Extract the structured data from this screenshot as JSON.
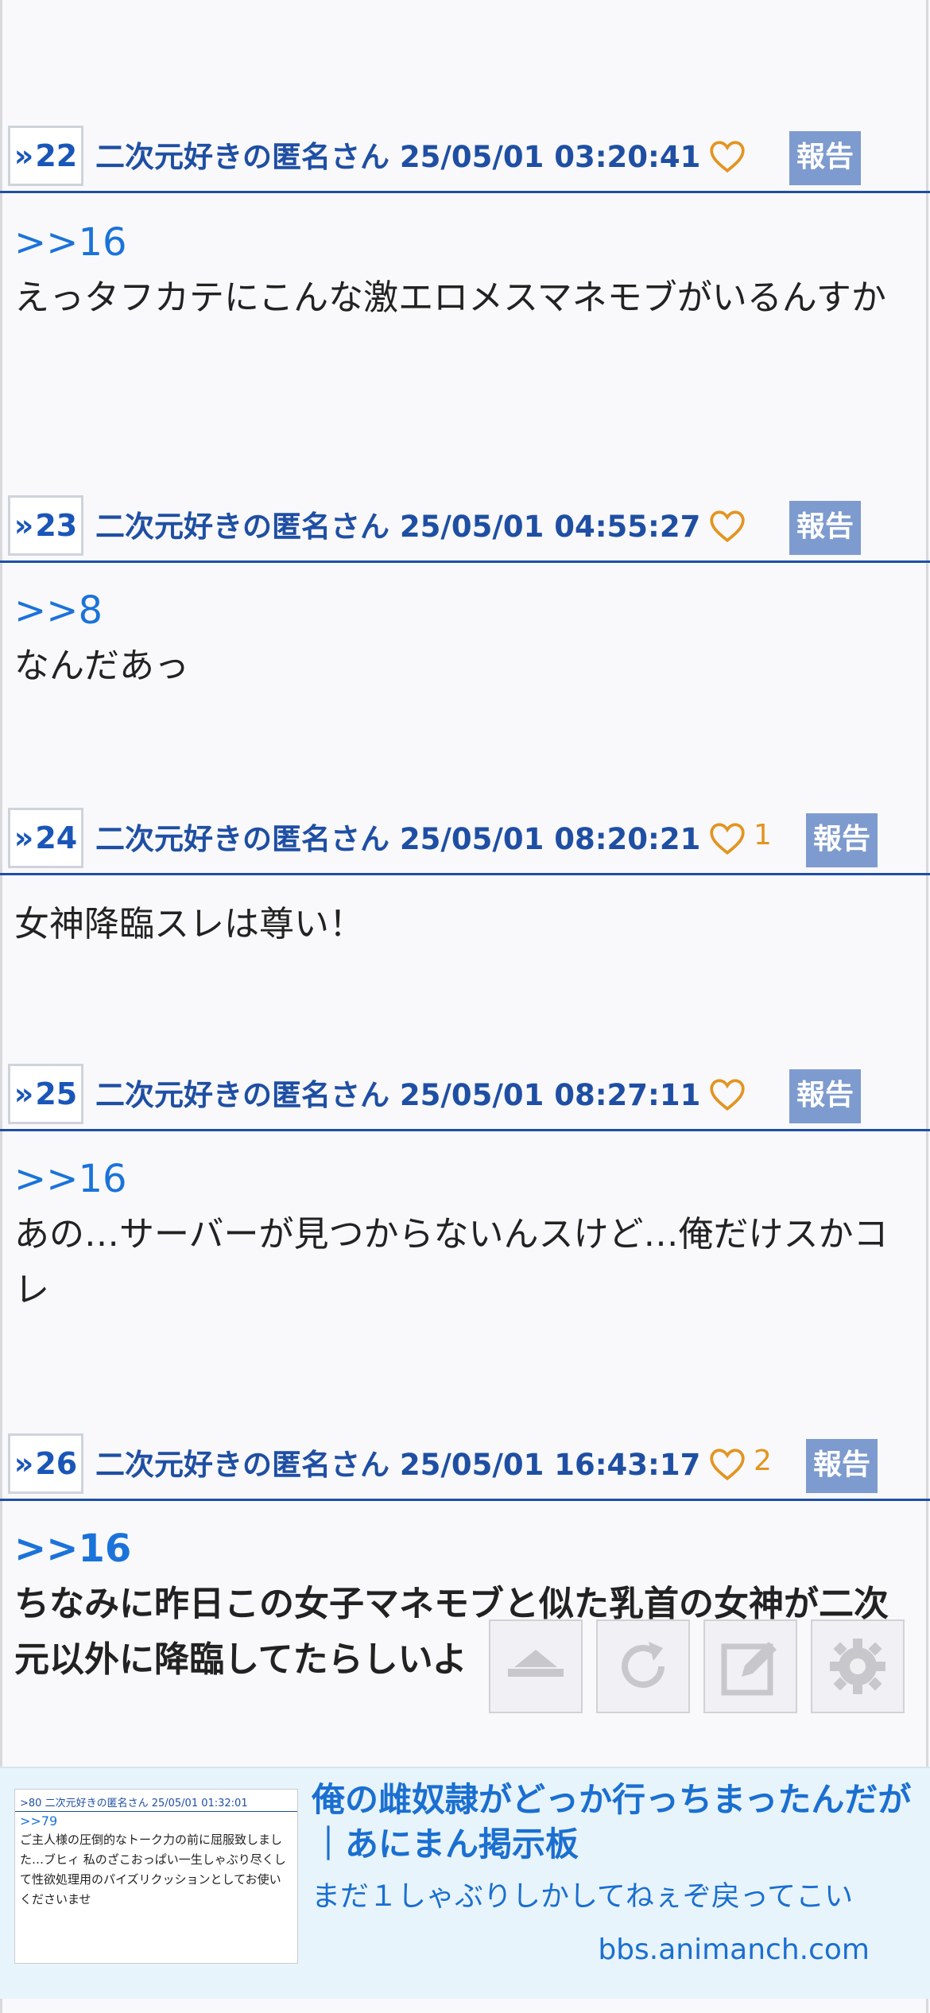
{
  "posts": [
    {
      "no": "22",
      "author": "二次元好きの匿名さん",
      "datetime": "25/05/01 03:20:41",
      "likes": "",
      "report": "報告",
      "anchor": ">>16",
      "text": "えっタフカテにこんな激エロメスマネモブがいるんすか"
    },
    {
      "no": "23",
      "author": "二次元好きの匿名さん",
      "datetime": "25/05/01 04:55:27",
      "likes": "",
      "report": "報告",
      "anchor": ">>8",
      "text": "なんだあっ"
    },
    {
      "no": "24",
      "author": "二次元好きの匿名さん",
      "datetime": "25/05/01 08:20:21",
      "likes": "1",
      "report": "報告",
      "anchor": "",
      "text": "女神降臨スレは尊い！"
    },
    {
      "no": "25",
      "author": "二次元好きの匿名さん",
      "datetime": "25/05/01 08:27:11",
      "likes": "",
      "report": "報告",
      "anchor": ">>16",
      "text": "あの…サーバーが見つからないんスけど…俺だけスかコレ"
    },
    {
      "no": "26",
      "author": "二次元好きの匿名さん",
      "datetime": "25/05/01 16:43:17",
      "likes": "2",
      "report": "報告",
      "anchor": ">>16",
      "text": "ちなみに昨日この女子マネモブと似た乳首の女神が二次元以外に降臨してたらしいよ"
    }
  ],
  "ad": {
    "title": "俺の雌奴隷がどっか行っちまったんだが｜あにまん掲示板",
    "description": "まだ１しゃぶりしかしてねぇぞ戻ってこい",
    "domain": "bbs.animanch.com",
    "thumb_header": ">80 二次元好きの匿名さん 25/05/01 01:32:01",
    "thumb_anchor": ">>79",
    "thumb_text": "ご主人様の圧倒的なトーク力の前に屈服致しました…ブヒィ 私のざこおっぱい一生しゃぶり尽くして性欲処理用のパイズリクッションとしてお使いくださいませ"
  },
  "toolbar": {
    "icons": [
      "scroll-top-icon",
      "refresh-icon",
      "compose-icon",
      "settings-icon"
    ]
  },
  "colors": {
    "header_blue": "#1f4fa3",
    "anchor_blue": "#1a73d9",
    "like_orange": "#e39420",
    "report_bg": "#7e9bcf"
  }
}
